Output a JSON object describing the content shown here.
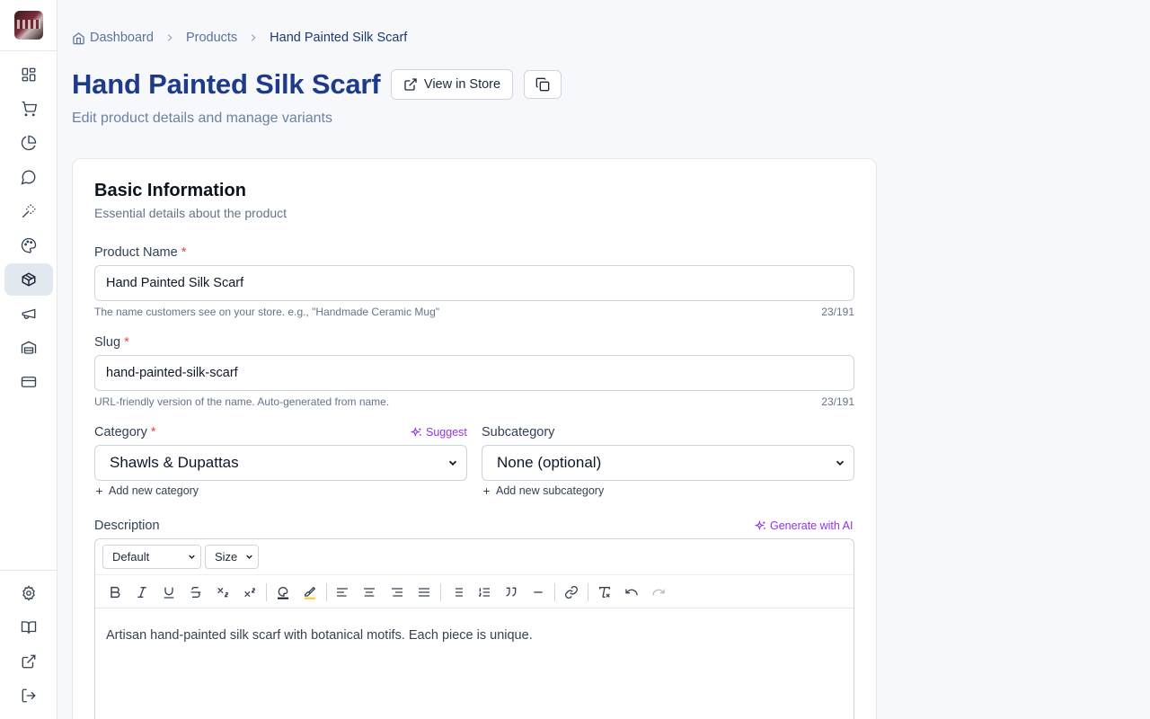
{
  "breadcrumb": {
    "home": "Dashboard",
    "section": "Products",
    "current": "Hand Painted Silk Scarf"
  },
  "header": {
    "title": "Hand Painted Silk Scarf",
    "view_button": "View in Store",
    "subtitle": "Edit product details and manage variants"
  },
  "sidebar": {
    "items": [
      {
        "icon": "dashboard-icon"
      },
      {
        "icon": "cart-icon"
      },
      {
        "icon": "pie-chart-icon"
      },
      {
        "icon": "message-icon"
      },
      {
        "icon": "magic-wand-icon"
      },
      {
        "icon": "palette-icon"
      },
      {
        "icon": "package-icon",
        "active": true
      },
      {
        "icon": "megaphone-icon"
      },
      {
        "icon": "warehouse-icon"
      },
      {
        "icon": "credit-card-icon"
      }
    ],
    "bottom": [
      {
        "icon": "gear-icon"
      },
      {
        "icon": "book-icon"
      },
      {
        "icon": "external-link-icon"
      },
      {
        "icon": "logout-icon"
      }
    ]
  },
  "card": {
    "title": "Basic Information",
    "subtitle": "Essential details about the product"
  },
  "form": {
    "required_mark": "*",
    "name": {
      "label": "Product Name",
      "value": "Hand Painted Silk Scarf",
      "hint": "The name customers see on your store. e.g., \"Handmade Ceramic Mug\"",
      "count": "23/191"
    },
    "slug": {
      "label": "Slug",
      "value": "hand-painted-silk-scarf",
      "hint": "URL-friendly version of the name. Auto-generated from name.",
      "count": "23/191"
    },
    "category": {
      "label": "Category",
      "suggest": "Suggest",
      "value": "Shawls & Dupattas",
      "add_link": "Add new category"
    },
    "subcategory": {
      "label": "Subcategory",
      "value": "None (optional)",
      "add_link": "Add new subcategory"
    },
    "description": {
      "label": "Description",
      "generate": "Generate with AI",
      "font_select": "Default",
      "size_select": "Size",
      "text": "Artisan hand-painted silk scarf with botanical motifs. Each piece is unique."
    }
  },
  "colors": {
    "title": "#1e3a8a",
    "accent_ai": "#9333ea",
    "required": "#ef4444"
  }
}
